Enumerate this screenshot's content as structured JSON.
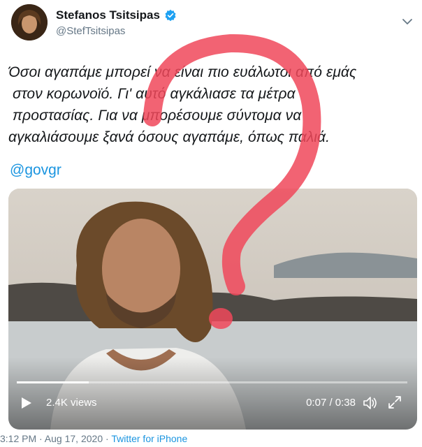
{
  "tweet": {
    "display_name": "Stefanos Tsitsipas",
    "handle": "@StefTsitsipas",
    "text_lines": [
      "Όσοι αγαπάμε μπορεί να είναι πιο ευάλωτοι από εμάς",
      "στον κορωνοϊό. Γι' αυτό αγκάλιασε τα μέτρα",
      "προστασίας. Για να μπορέσουμε σύντομα να",
      "αγκαλιάσουμε ξανά όσους αγαπάμε, όπως παλιά."
    ],
    "mention": "@govgr",
    "timestamp": "3:12 PM · Aug 17, 2020",
    "separator": " · ",
    "source": "Twitter for iPhone"
  },
  "video": {
    "views": "2.4K views",
    "time": "0:07 / 0:38",
    "progress": 0.184
  },
  "icons": {
    "verified": "verified-badge-icon",
    "menu": "chevron-down-icon",
    "play": "play-icon",
    "volume": "volume-icon",
    "fullscreen": "expand-icon"
  },
  "colors": {
    "link": "#1b95e0",
    "verified": "#1da1f2",
    "annotation": "#f0485a"
  }
}
